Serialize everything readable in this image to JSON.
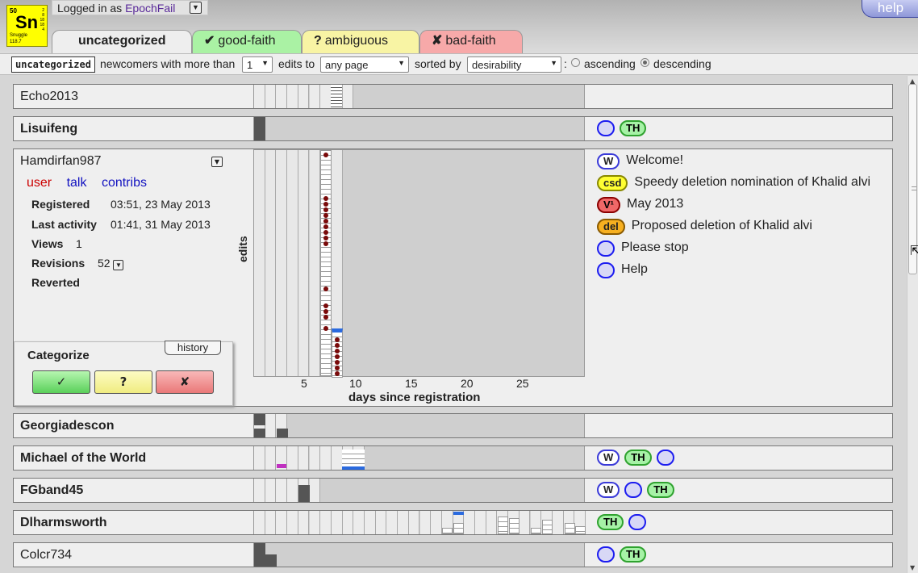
{
  "logo": {
    "number": "50",
    "symbol": "Sn",
    "name": "Snuggle",
    "mass": "118.7",
    "side": "2\n8\n18\n18\n4"
  },
  "login": {
    "prefix": "Logged in as ",
    "user": "EpochFail"
  },
  "help_label": "help",
  "tabs": [
    {
      "label": "uncategorized",
      "icon": ""
    },
    {
      "label": "good-faith",
      "icon": "✔"
    },
    {
      "label": "ambiguous",
      "icon": "?"
    },
    {
      "label": "bad-faith",
      "icon": "✘"
    }
  ],
  "filter": {
    "category": "uncategorized",
    "text1": "newcomers with more than",
    "min_edits": "1",
    "text2": "edits to",
    "namespace": "any page",
    "text3": "sorted by",
    "sort": "desirability",
    "colon": ":",
    "asc": "ascending",
    "desc": "descending",
    "selected_order": "descending"
  },
  "users": [
    {
      "name": "Echo2013",
      "bold": false
    },
    {
      "name": "Lisuifeng",
      "bold": true
    },
    {
      "name": "Georgiadescon",
      "bold": true
    },
    {
      "name": "Michael of the World",
      "bold": true
    },
    {
      "name": "FGband45",
      "bold": true
    },
    {
      "name": "Dlharmsworth",
      "bold": true
    },
    {
      "name": "Colcr734",
      "bold": false
    }
  ],
  "expanded": {
    "name": "Hamdirfan987",
    "links": {
      "user": "user",
      "talk": "talk",
      "contribs": "contribs"
    },
    "registered_label": "Registered",
    "registered": "03:51, 23 May 2013",
    "last_activity_label": "Last activity",
    "last_activity": "01:41, 31 May 2013",
    "views_label": "Views",
    "views": "1",
    "revisions_label": "Revisions",
    "revisions": "52",
    "reverted_label": "Reverted",
    "categorize": {
      "title": "Categorize",
      "history": "history",
      "good": "✓",
      "ambiguous": "?",
      "bad": "✘"
    },
    "chart": {
      "ylabel": "edits",
      "xlabel": "days since registration",
      "xticks": [
        "5",
        "10",
        "15",
        "20",
        "25"
      ]
    },
    "actions": [
      {
        "badge": "W",
        "style": "w",
        "label": "Welcome!"
      },
      {
        "badge": "csd",
        "style": "csd",
        "label": "Speedy deletion nomination of Khalid alvi"
      },
      {
        "badge": "V¹",
        "style": "v",
        "label": "May 2013"
      },
      {
        "badge": "del",
        "style": "del",
        "label": "Proposed deletion of Khalid alvi"
      },
      {
        "badge": "",
        "style": "circ",
        "label": "Please stop"
      },
      {
        "badge": "",
        "style": "circ",
        "label": "Help"
      }
    ]
  },
  "row_actions": {
    "lisuifeng": [
      "",
      "TH"
    ],
    "michael": [
      "W",
      "TH",
      ""
    ],
    "fgband": [
      "W",
      "",
      "TH"
    ],
    "dlharms": [
      "TH",
      ""
    ],
    "colcr": [
      "",
      "TH"
    ]
  },
  "icons": {
    "dropdown": "chevron-down-icon",
    "cursor": "resize-cursor-icon"
  }
}
